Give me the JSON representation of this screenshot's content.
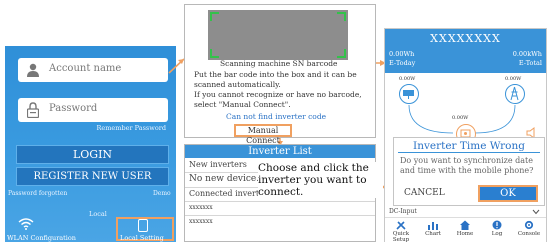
{
  "login": {
    "account_placeholder": "Account name",
    "password_placeholder": "Password",
    "remember_label": "Remember Password",
    "login_label": "LOGIN",
    "register_label": "REGISTER NEW USER",
    "forgot_label": "Password forgotten",
    "demo_label": "Demo",
    "local_label": "Local",
    "wlan_label": "WLAN Configuration",
    "local_setting_label": "Local Setting"
  },
  "scan": {
    "title": "Scanning machine SN barcode",
    "line1": "Put the bar code into the box and it can be",
    "line2": "scanned automatically.",
    "line3": "If you cannot recognize or have no barcode,",
    "line4": "select \"Manual Connect\".",
    "cannot_find": "Can not find inverter code",
    "manual_connect": "Manual Connect"
  },
  "inverter_list": {
    "title": "Inverter List",
    "new_header": "New inverters",
    "new_device": "No new device...",
    "connected_header": "Connected inverters",
    "items": [
      "xxxxxxx",
      "xxxxxxx"
    ]
  },
  "hint": "Choose and click the inverter you want to connect.",
  "app": {
    "title": "XXXXXXXX",
    "today_value": "0.00Wh",
    "today_label": "E-Today",
    "total_value": "0.00kWh",
    "total_label": "E-Total",
    "pv_power": "0.00W",
    "grid_power": "0.00W",
    "inv_power": "0.00W",
    "dialog": {
      "title": "Inverter Time Wrong",
      "message": "Do you want to synchronize date and time with the mobile phone?",
      "cancel": "CANCEL",
      "ok": "OK"
    },
    "dc_input": "DC-Input",
    "nav": [
      "Quick Setup",
      "Chart",
      "Home",
      "Log",
      "Console"
    ]
  },
  "colors": {
    "accent": "#3a93d8",
    "highlight": "#f0a060",
    "arrow": "#f0a060"
  }
}
